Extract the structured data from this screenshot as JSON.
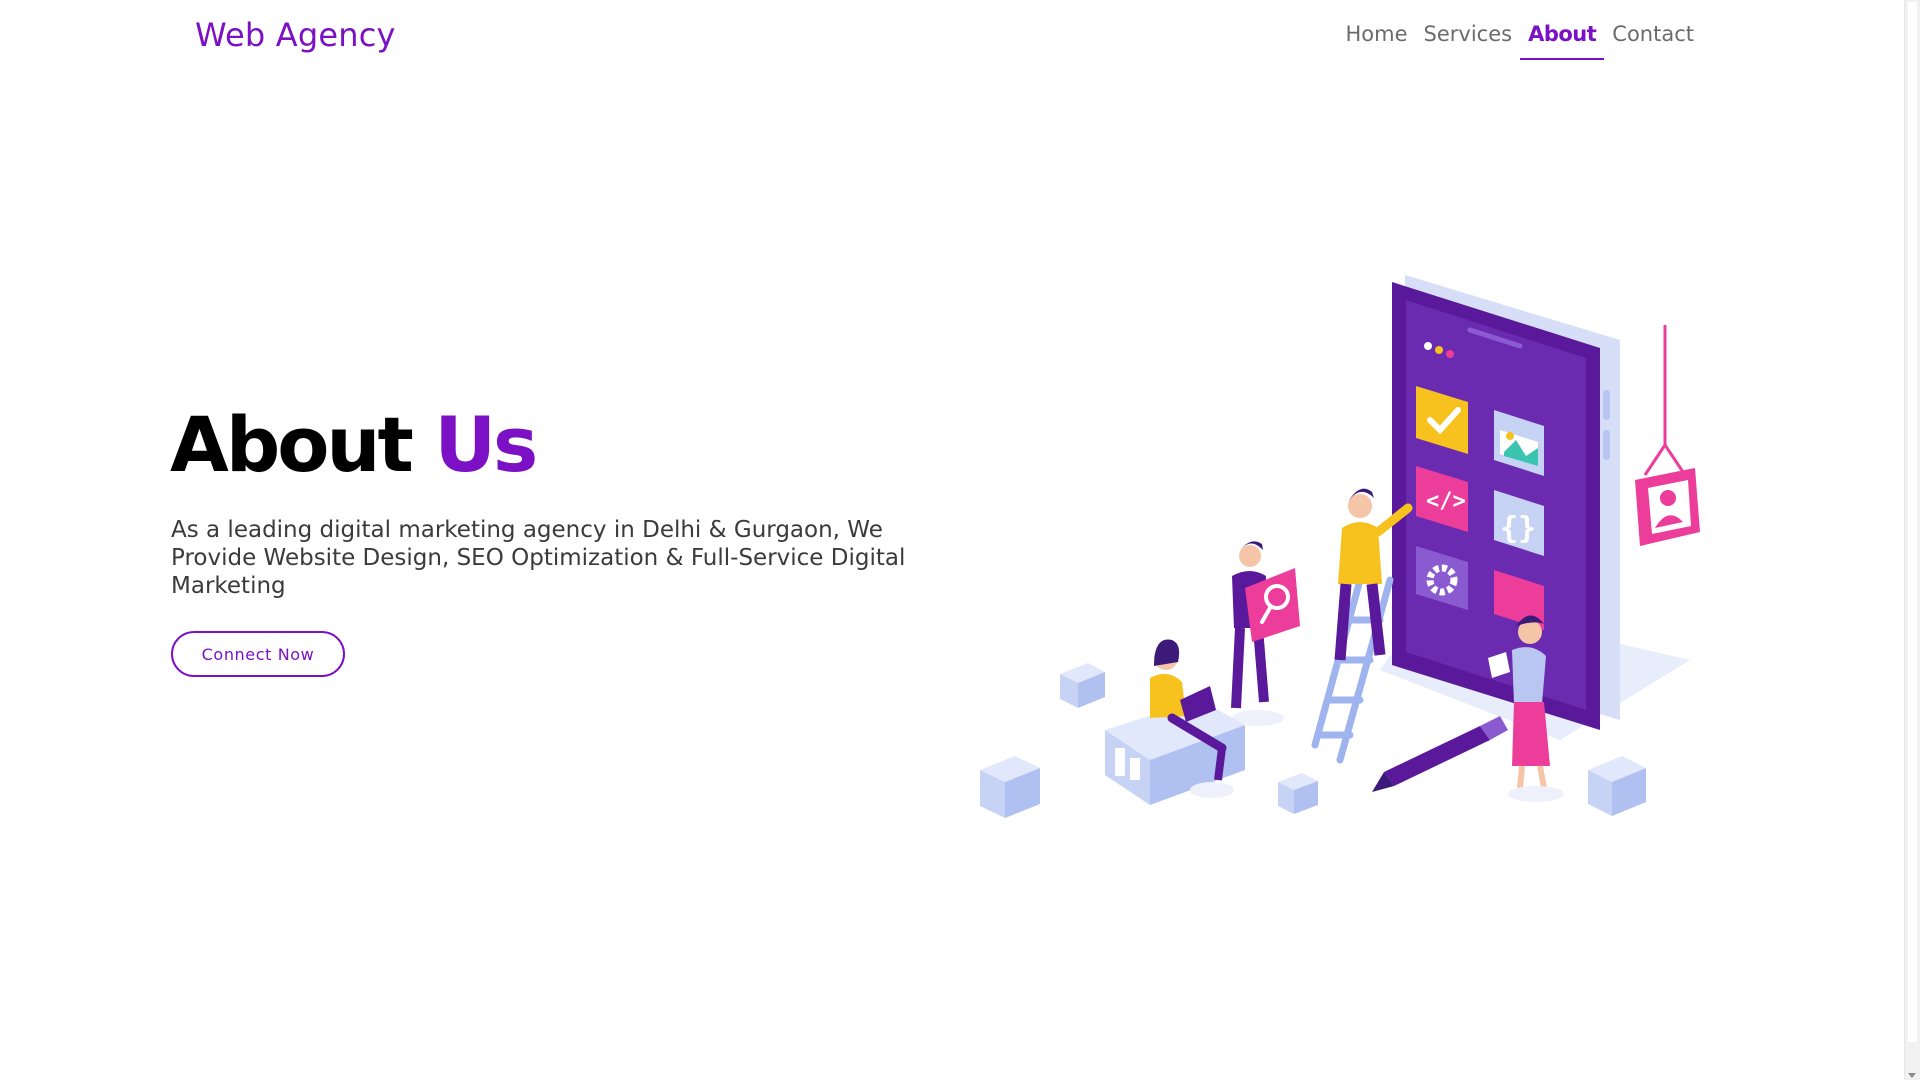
{
  "brand": {
    "name": "Web Agency"
  },
  "nav": {
    "items": [
      {
        "label": "Home",
        "active": false
      },
      {
        "label": "Services",
        "active": false
      },
      {
        "label": "About",
        "active": true
      },
      {
        "label": "Contact",
        "active": false
      }
    ]
  },
  "hero": {
    "title_main": "About",
    "title_accent": "Us",
    "description": "As a leading digital marketing agency in Delhi & Gurgaon, We Provide Website Design, SEO Optimization & Full-Service Digital Marketing",
    "cta_label": "Connect Now"
  },
  "colors": {
    "accent": "#7b10c4",
    "phone_body": "#5a189a",
    "pink": "#ec3d9b",
    "yellow": "#f7c21e",
    "light_blue": "#c7d3f5"
  },
  "illustration": {
    "icons": [
      "phone-call-icon",
      "image-icon",
      "code-icon",
      "braces-icon",
      "gear-icon",
      "user-card-icon",
      "search-icon",
      "pen-icon"
    ]
  }
}
